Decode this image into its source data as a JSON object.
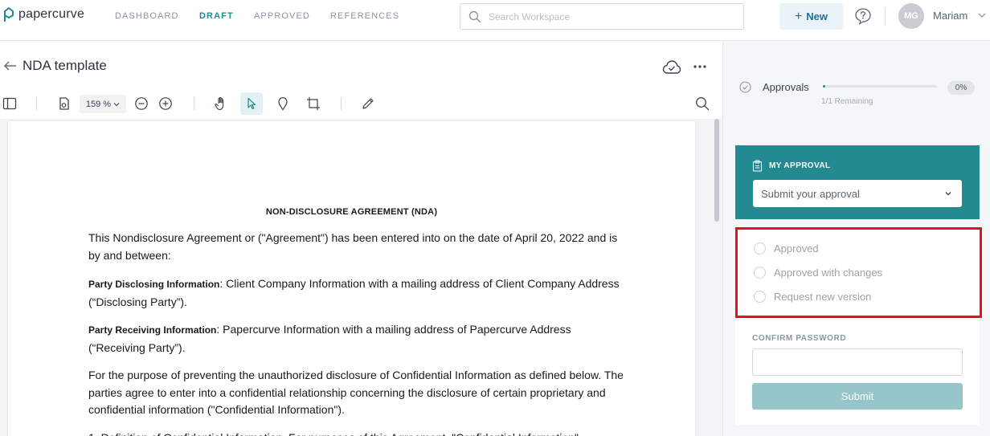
{
  "brand": {
    "name": "papercurve",
    "accent": "#1f8a91"
  },
  "nav": {
    "links": [
      {
        "label": "DASHBOARD",
        "active": false
      },
      {
        "label": "DRAFT",
        "active": true
      },
      {
        "label": "APPROVED",
        "active": false
      },
      {
        "label": "REFERENCES",
        "active": false
      }
    ],
    "search_placeholder": "Search Workspace",
    "new_label": "New",
    "user_initials": "MG",
    "user_name": "Mariam"
  },
  "document": {
    "title": "NDA template",
    "zoom": "159 %",
    "heading": "NON-DISCLOSURE AGREEMENT (NDA)",
    "paragraphs": {
      "intro": "This Nondisclosure Agreement or (\"Agreement\") has been entered into on the date of April 20, 2022 and is by and between:",
      "disclosing_label": "Party Disclosing Information",
      "disclosing_text": ": Client Company Information  with a mailing address of Client Company Address (“Disclosing Party”).",
      "receiving_label": "Party Receiving Information",
      "receiving_text": ": Papercurve Information  with a mailing address of Papercurve Address (“Receiving Party”).",
      "purpose": "For the purpose of preventing the unauthorized disclosure of Confidential Information as defined below. The parties agree to enter into a confidential relationship concerning the disclosure of certain proprietary and confidential information (\"Confidential Information\").",
      "definition_peek": "1. Definition of Confidential Information. For purposes of this Agreement, \"Confidential Information\""
    }
  },
  "approvals": {
    "label": "Approvals",
    "percent": "0%",
    "progress_fraction": 0.0,
    "remaining": "1/1 Remaining"
  },
  "my_approval": {
    "heading": "MY APPROVAL",
    "select_value": "Submit your approval",
    "options": [
      {
        "label": "Approved"
      },
      {
        "label": "Approved with changes"
      },
      {
        "label": "Request new version"
      }
    ],
    "password_label": "CONFIRM PASSWORD",
    "submit_label": "Submit"
  },
  "references_label": "References",
  "icons": [
    "logo-icon",
    "search-icon",
    "plus-icon",
    "help-icon",
    "chevron-down-icon",
    "back-arrow-icon",
    "cloud-check-icon",
    "more-icon",
    "sidebar-toggle-icon",
    "page-icon",
    "zoom-out-icon",
    "zoom-in-icon",
    "hand-icon",
    "pointer-icon",
    "pin-icon",
    "crop-icon",
    "pen-icon",
    "clipboard-icon",
    "check-circle-icon"
  ]
}
